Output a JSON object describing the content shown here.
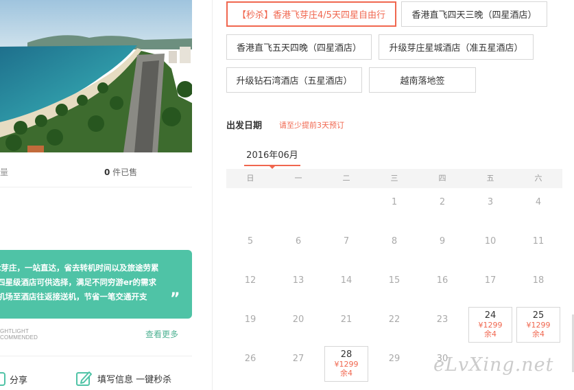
{
  "left": {
    "sales_cut": "量",
    "sales_count_num": "0",
    "sales_count_unit": " 件已售",
    "intro_lines": [
      "t芽庄，一站直达，省去转机时间以及旅途劳累",
      "四星级酒店可供选择，满足不同穷游er的需求",
      "机场至酒店往返接送机，节省一笔交通开支"
    ],
    "quote": "”",
    "rec_line1": "GHTLIGHT",
    "rec_line2": "COMMENDED",
    "more_link": "查看更多",
    "share_label": "分享",
    "fill_label": "填写信息 一键秒杀"
  },
  "options": [
    {
      "label": "【秒杀】香港飞芽庄4/5天四星自由行",
      "selected": true
    },
    {
      "label": "香港直飞四天三晚（四星酒店）",
      "selected": false
    },
    {
      "label": "香港直飞五天四晚（四星酒店）",
      "selected": false
    },
    {
      "label": "升级芽庄星城酒店（准五星酒店）",
      "selected": false
    },
    {
      "label": "升级钻石湾酒店（五星酒店）",
      "selected": false
    },
    {
      "label": "越南落地签",
      "selected": false
    }
  ],
  "date_section": {
    "title": "出发日期",
    "hint": "请至少提前3天预订",
    "month": "2016年06月",
    "weekdays": [
      "日",
      "一",
      "二",
      "三",
      "四",
      "五",
      "六"
    ]
  },
  "calendar": {
    "days": [
      "",
      "",
      "",
      "1",
      "2",
      "3",
      "4",
      "5",
      "6",
      "7",
      "8",
      "9",
      "10",
      "11",
      "12",
      "13",
      "14",
      "15",
      "16",
      "17",
      "18",
      "19",
      "20",
      "21",
      "22",
      "23",
      "24",
      "25",
      "26",
      "27",
      "28",
      "29",
      "30",
      "",
      ""
    ],
    "available": {
      "24": {
        "price": "¥1299",
        "left": "余4"
      },
      "25": {
        "price": "¥1299",
        "left": "余4"
      },
      "28": {
        "price": "¥1299",
        "left": "余4"
      }
    }
  },
  "watermark": "eLvXing.net",
  "colors": {
    "accent": "#f0664e",
    "green": "#4fc3a6",
    "link_green": "#4fb293"
  }
}
